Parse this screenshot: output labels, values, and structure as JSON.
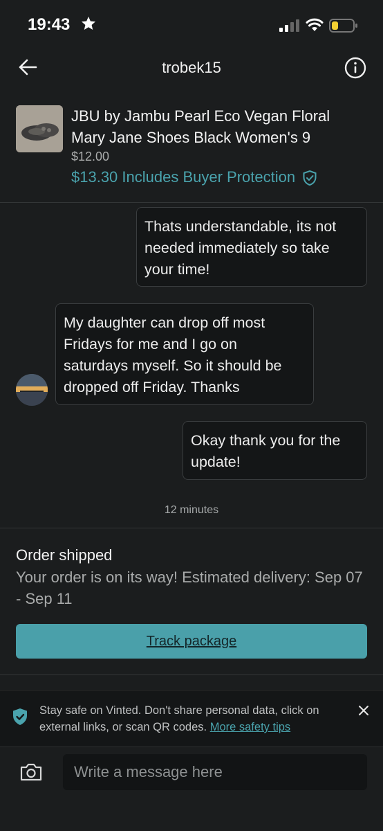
{
  "status_bar": {
    "time": "19:43"
  },
  "header": {
    "title": "trobek15"
  },
  "item": {
    "title": "JBU by Jambu Pearl Eco Vegan Floral Mary Jane Shoes Black Women's 9",
    "price": "$12.00",
    "total_price": "$13.30",
    "buyer_protection_label": "Includes Buyer Protection"
  },
  "messages": [
    {
      "from": "me",
      "text": "Thats understandable, its not needed immediately so take your time!"
    },
    {
      "from": "other",
      "text": "My daughter can drop off most Fridays for me and I go on saturdays myself. So it should be dropped off Friday. Thanks"
    },
    {
      "from": "me",
      "text": "Okay thank you for the update!"
    }
  ],
  "timestamp": "12 minutes",
  "order": {
    "title": "Order shipped",
    "text": "Your order is on its way! Estimated delivery: Sep 07 - Sep 11",
    "button_label": "Track package"
  },
  "safety": {
    "text": "Stay safe on Vinted. Don't share personal data, click on external links, or scan QR codes.",
    "link_label": "More safety tips"
  },
  "composer": {
    "placeholder": "Write a message here"
  },
  "colors": {
    "accent": "#4aa3ad",
    "background": "#1b1d1e",
    "bubble": "#141617"
  }
}
